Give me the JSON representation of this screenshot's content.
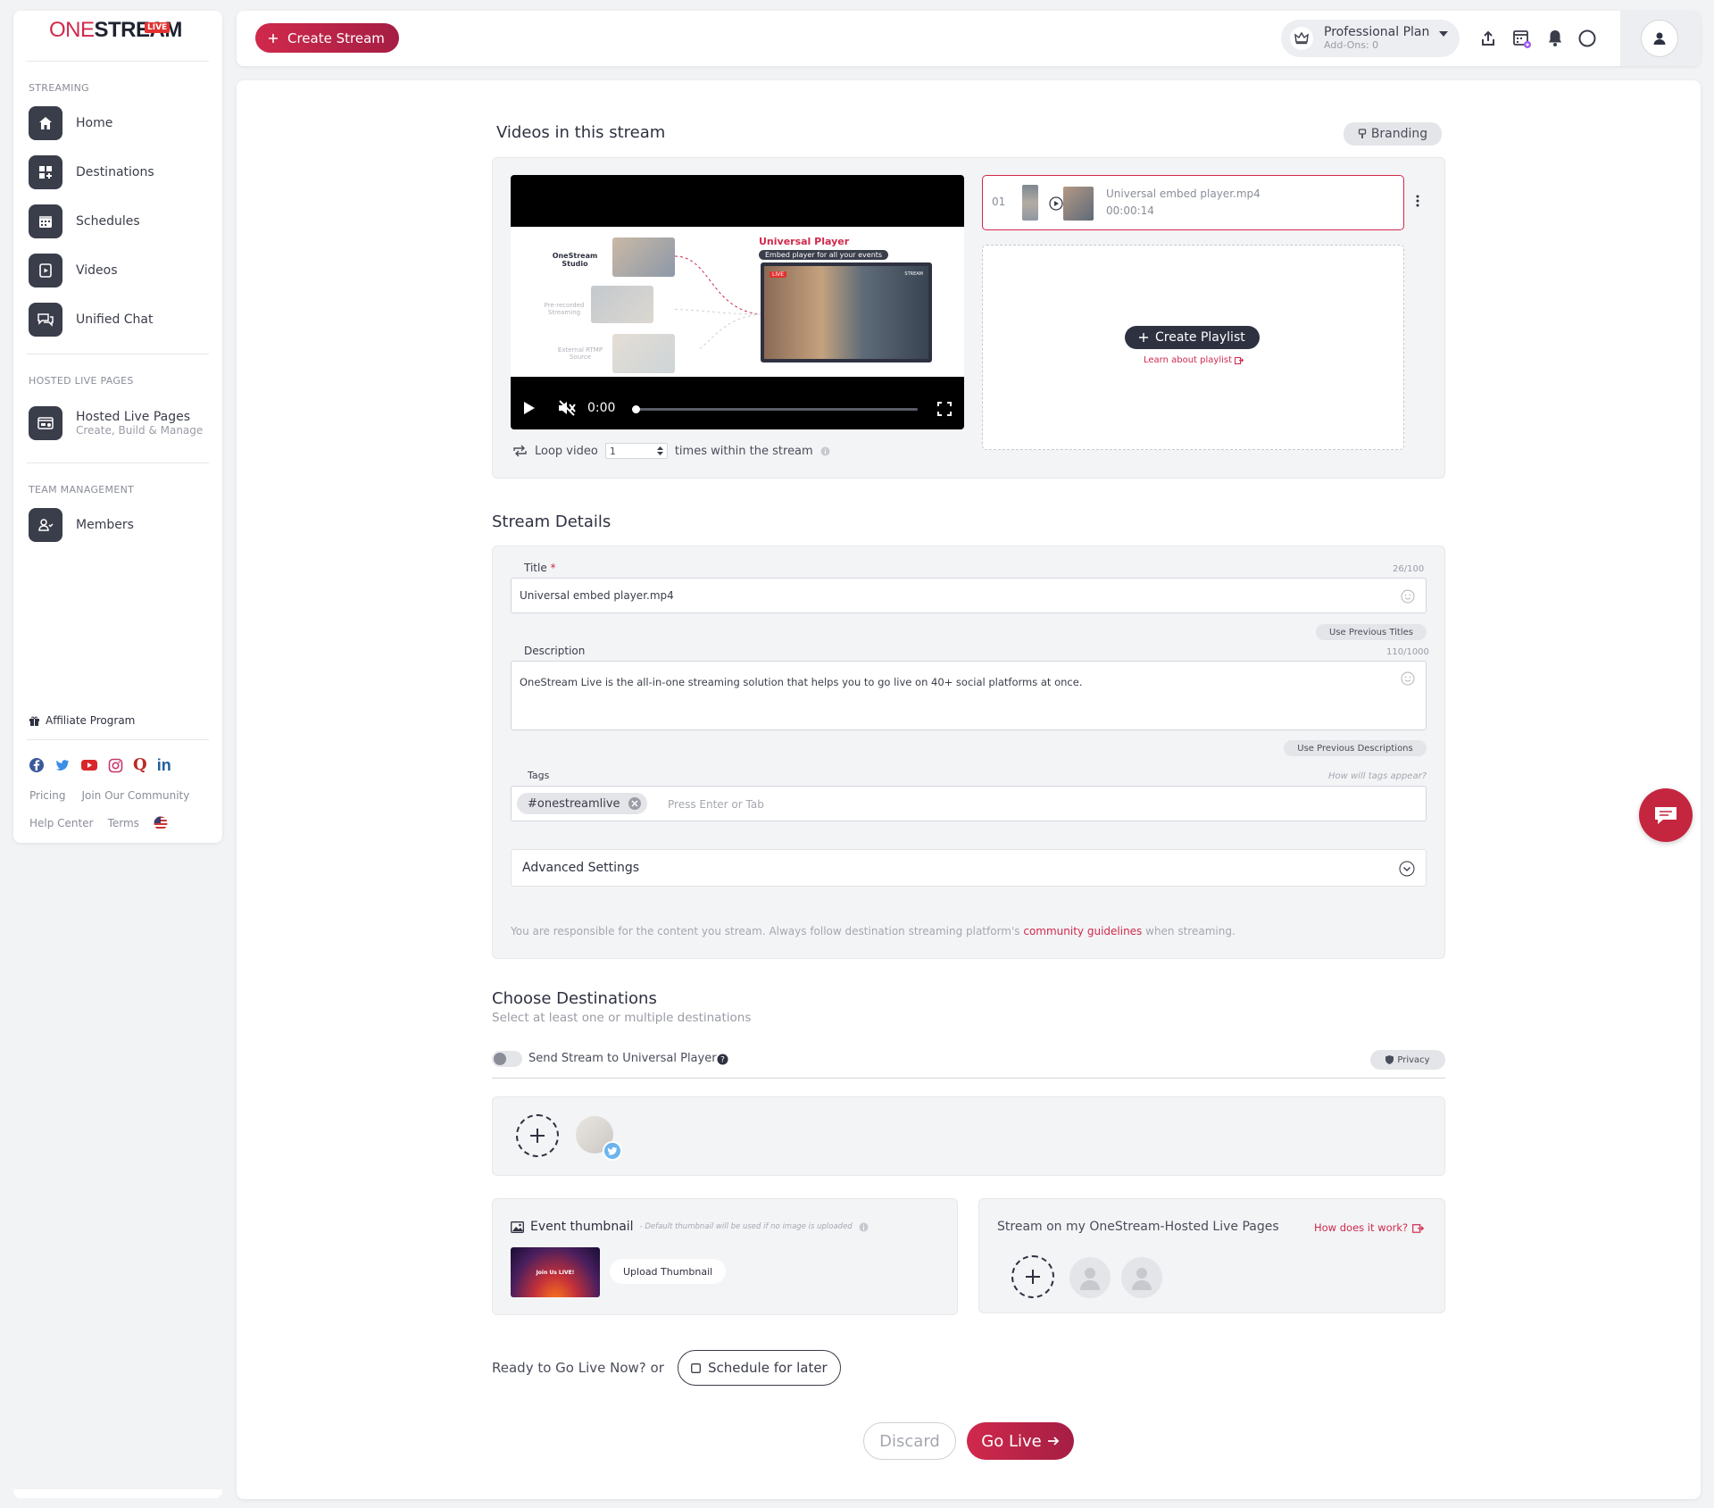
{
  "sidebar": {
    "logo": {
      "part1": "ONE",
      "part2": "STREAM",
      "badge": "LIVE"
    },
    "sections": {
      "streaming": "STREAMING",
      "hosted": "HOSTED LIVE PAGES",
      "team": "TEAM MANAGEMENT"
    },
    "items": {
      "home": "Home",
      "destinations": "Destinations",
      "schedules": "Schedules",
      "videos": "Videos",
      "chat": "Unified Chat",
      "hosted": "Hosted Live Pages",
      "hosted_sub": "Create, Build & Manage",
      "members": "Members"
    },
    "affiliate": "Affiliate Program",
    "footer": {
      "pricing": "Pricing",
      "community": "Join Our Community",
      "help": "Help Center",
      "terms": "Terms"
    }
  },
  "topbar": {
    "create_stream": "Create Stream",
    "plan_name": "Professional Plan",
    "plan_addons": "Add-Ons: 0"
  },
  "videos": {
    "heading": "Videos in this stream",
    "branding": "Branding",
    "preview": {
      "brand": "OneStream Studio",
      "prerecorded": "Pre-recorded Streaming",
      "rtmp": "External RTMP Source",
      "title": "Universal Player",
      "subtitle": "Embed player for all your events",
      "live": "LIVE",
      "stream_mark": "STREAM"
    },
    "player": {
      "time": "0:00",
      "progress": 0
    },
    "playlist_item": {
      "index": "01",
      "name": "Universal embed player.mp4",
      "duration": "00:00:14"
    },
    "create_playlist": "Create Playlist",
    "learn_playlist": "Learn about playlist",
    "loop_label": "Loop video",
    "loop_value": "1",
    "loop_suffix": "times within the stream"
  },
  "details": {
    "heading": "Stream Details",
    "title_label": "Title",
    "title_required": "*",
    "title_counter": "26/100",
    "title_value": "Universal embed player.mp4",
    "use_prev_titles": "Use Previous Titles",
    "desc_label": "Description",
    "desc_counter": "110/1000",
    "desc_value": "OneStream Live is the all-in-one streaming solution that helps you to go live on 40+ social platforms at once.",
    "use_prev_desc": "Use Previous Descriptions",
    "tags_label": "Tags",
    "tags_hint": "How will tags appear?",
    "tag": "#onestreamlive",
    "tags_placeholder": "Press Enter or Tab",
    "advanced": "Advanced Settings",
    "disclaimer_pre": "You are responsible for the content you stream. Always follow destination streaming platform's ",
    "disclaimer_link": "community guidelines",
    "disclaimer_post": " when streaming."
  },
  "destinations": {
    "heading": "Choose Destinations",
    "sub": "Select at least one or multiple destinations",
    "universal_toggle": "Send Stream to Universal Player",
    "privacy": "Privacy"
  },
  "thumbnail": {
    "label": "Event thumbnail",
    "hint": "- Default thumbnail will be used if no image is uploaded",
    "thumb_text": "Join Us LIVE!",
    "upload": "Upload Thumbnail"
  },
  "hosted_pages": {
    "label": "Stream on my OneStream-Hosted Live Pages",
    "how": "How does it work?"
  },
  "footer_actions": {
    "ready": "Ready to Go Live Now? or",
    "schedule": "Schedule for later",
    "discard": "Discard",
    "go_live": "Go Live"
  },
  "colors": {
    "accent": "#d0294c",
    "dark": "#3a3d4a",
    "panel": "#f3f4f6"
  }
}
